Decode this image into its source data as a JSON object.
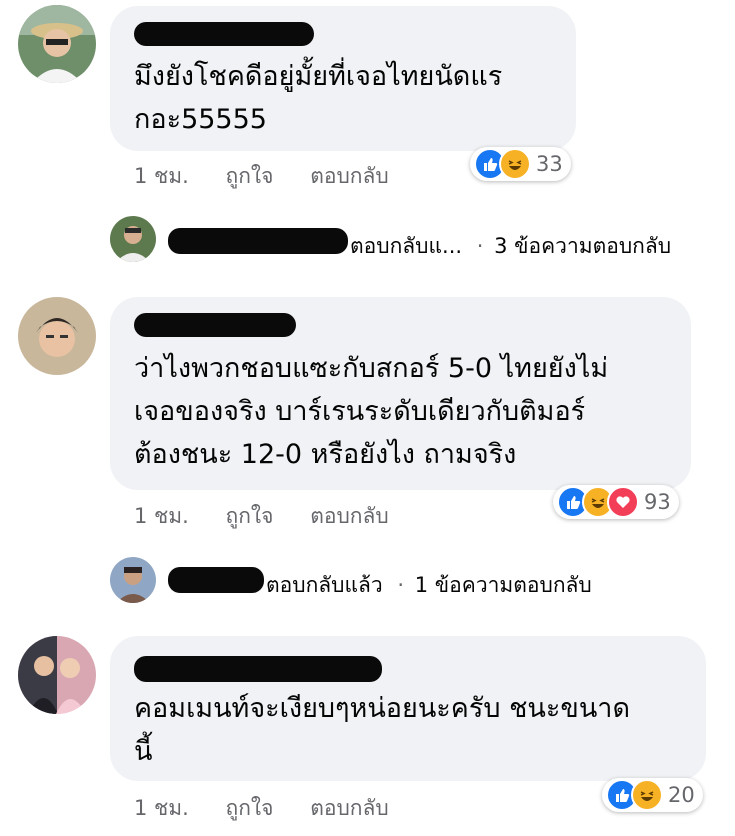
{
  "comments": [
    {
      "text_lines": [
        "มึงยังโชคดีอยู่มั้ยที่เจอไทยนัดแร",
        "กอะ55555"
      ],
      "time": "1 ชม.",
      "like_label": "ถูกใจ",
      "reply_label": "ตอบกลับ",
      "reaction_count": "33",
      "reactions": [
        "like-icon",
        "haha-icon"
      ],
      "reply_summary": {
        "text": "ตอบกลับแ...",
        "sep": "·",
        "count": "3 ข้อความตอบกลับ"
      }
    },
    {
      "text_lines": [
        "ว่าไงพวกชอบแซะกับสกอร์ 5-0 ไทยยังไม่",
        "เจอของจริง บาร์เรนระดับเดียวกับติมอร์",
        "ต้องชนะ 12-0 หรือยังไง ถามจริง"
      ],
      "time": "1 ชม.",
      "like_label": "ถูกใจ",
      "reply_label": "ตอบกลับ",
      "reaction_count": "93",
      "reactions": [
        "like-icon",
        "haha-icon",
        "love-icon"
      ],
      "reply_summary": {
        "text": "ตอบกลับแล้ว",
        "sep": "·",
        "count": "1 ข้อความตอบกลับ"
      }
    },
    {
      "text_lines": [
        "คอมเมนท์จะเงียบๆหน่อยนะครับ ชนะขนาด",
        "นี้"
      ],
      "time": "1 ชม.",
      "like_label": "ถูกใจ",
      "reply_label": "ตอบกลับ",
      "reaction_count": "20",
      "reactions": [
        "like-icon",
        "haha-icon"
      ]
    }
  ],
  "colors": {
    "bubble": "#f0f2f5",
    "meta": "#65676b",
    "like": "#1877f2",
    "haha": "#f7b125",
    "love": "#f33e58"
  }
}
